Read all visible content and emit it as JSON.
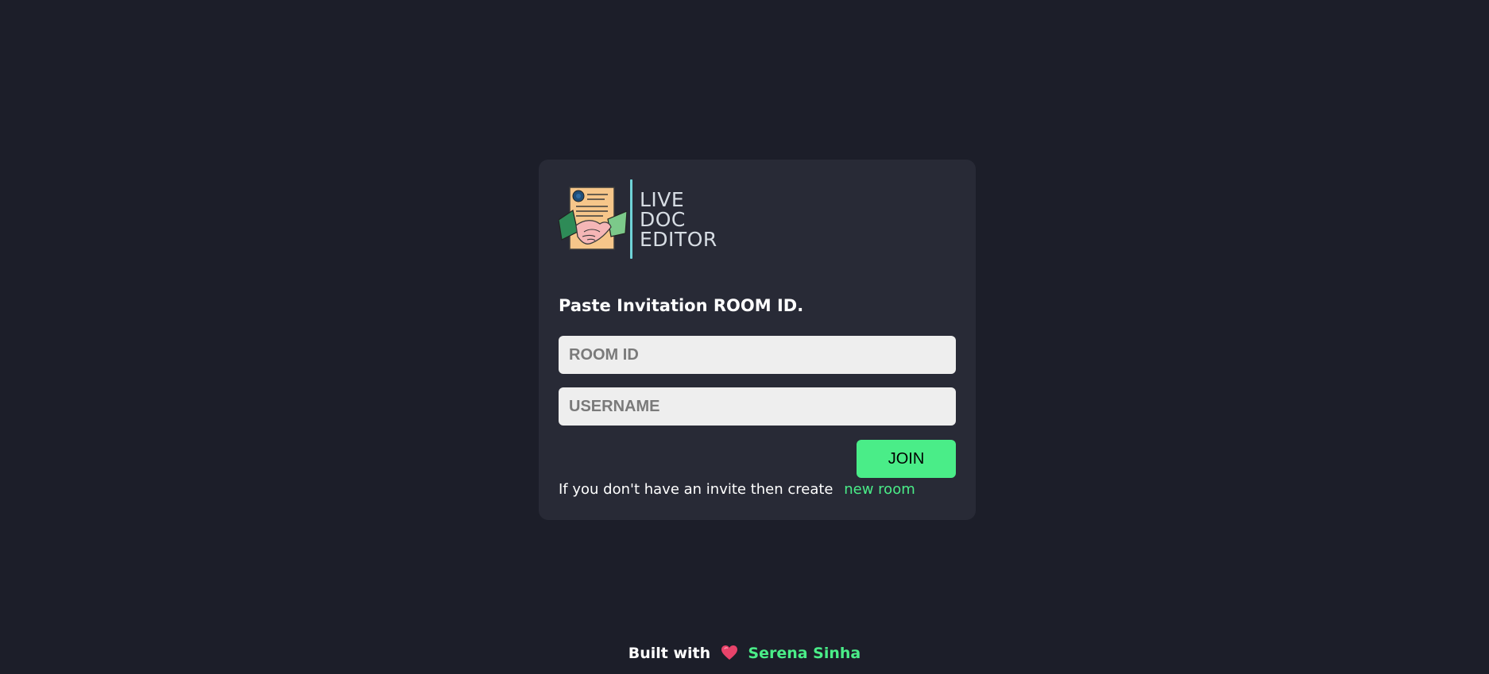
{
  "logo": {
    "lines": [
      "LIVE",
      "DOC",
      "EDITOR"
    ]
  },
  "form": {
    "heading": "Paste Invitation ROOM ID.",
    "room_placeholder": "ROOM ID",
    "username_placeholder": "USERNAME",
    "join_label": "JOIN",
    "invite_text": "If you don't have an invite then create",
    "invite_link": "new room"
  },
  "footer": {
    "prefix": "Built with",
    "heart_icon": "heart-icon",
    "author": "Serena Sinha"
  },
  "colors": {
    "background": "#1c1e29",
    "card": "#282a36",
    "accent": "#4aed88",
    "logo_divider": "#6fd3d8"
  }
}
